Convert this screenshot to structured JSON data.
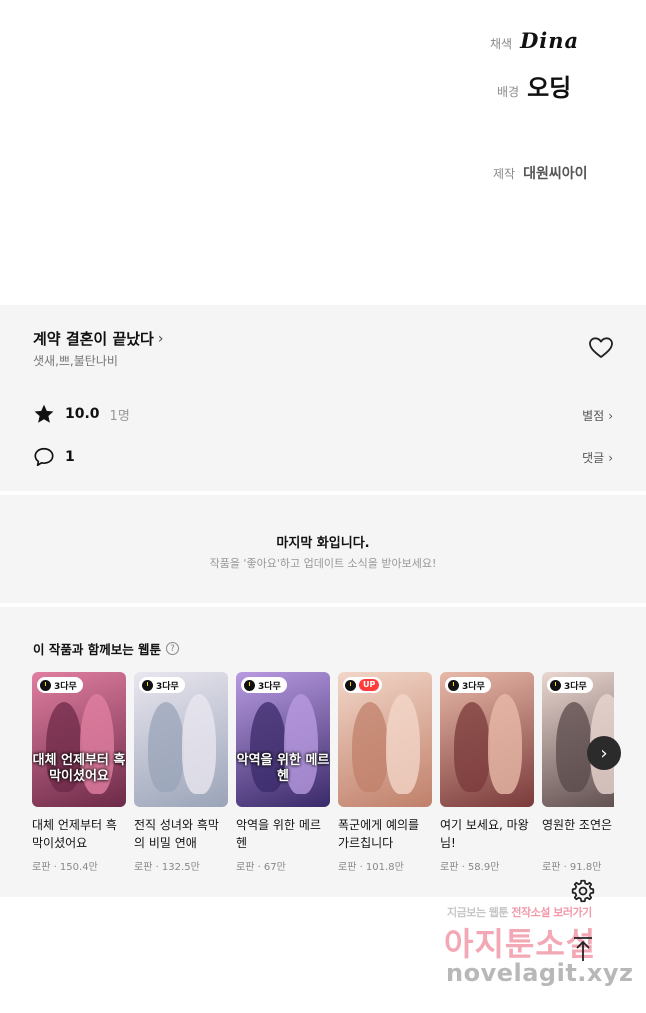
{
  "credits": [
    {
      "role": "채색",
      "name": "Dina"
    },
    {
      "role": "배경",
      "name": "오딩"
    },
    {
      "role": "제작",
      "name": "대원씨아이"
    }
  ],
  "series": {
    "title": "계약 결혼이 끝났다",
    "title_chevron": "›",
    "authors": "샛새,쁘,불탄나비",
    "rating": "10.0",
    "rating_count": "1명",
    "rating_link": "별점",
    "comment_count": "1",
    "comment_link": "댓글",
    "link_chevron": "›"
  },
  "last_episode": {
    "title": "마지막 화입니다.",
    "subtitle": "작품을 '좋아요'하고 업데이트 소식을 받아보세요!"
  },
  "recommend": {
    "heading": "이 작품과 함께보는 웹툰",
    "help": "?",
    "next": "›",
    "cards": [
      {
        "badge": "3다무",
        "badge_type": "wait",
        "thumb_text": "대체 언제부터 흑막이셨어요",
        "name": "대체 언제부터 흑막이셨어요",
        "meta": "로판 · 150.4만",
        "c1": "#6d2a48",
        "c2": "#e07ea0"
      },
      {
        "badge": "3다무",
        "badge_type": "wait",
        "thumb_text": "",
        "name": "전직 성녀와 흑막의 비밀 연애",
        "meta": "로판 · 132.5만",
        "c1": "#9aa4b8",
        "c2": "#e9e6ef"
      },
      {
        "badge": "3다무",
        "badge_type": "wait",
        "thumb_text": "악역을 위한 메르헨",
        "name": "악역을 위한 메르헨",
        "meta": "로판 · 67만",
        "c1": "#3a2a6a",
        "c2": "#b89ae0"
      },
      {
        "badge": "UP",
        "badge_type": "up",
        "thumb_text": "",
        "name": "폭군에게 예의를 가르칩니다",
        "meta": "로판 · 101.8만",
        "c1": "#c0806a",
        "c2": "#f2d6c8"
      },
      {
        "badge": "3다무",
        "badge_type": "wait",
        "thumb_text": "",
        "name": "여기 보세요, 마왕님!",
        "meta": "로판 · 58.9만",
        "c1": "#7a3a3a",
        "c2": "#e8b9a8"
      },
      {
        "badge": "3다무",
        "badge_type": "wait",
        "thumb_text": "",
        "name": "영원한 조연은 다",
        "meta": "로판 · 91.8만",
        "c1": "#5a4a4a",
        "c2": "#ead6d0"
      }
    ]
  },
  "watermark": {
    "line1_a": "지금보는 웹툰 ",
    "line1_b": "전작소설 ",
    "line1_c": "보러가기",
    "line2": "아지툰소설",
    "line3": "novelagit.xyz"
  },
  "icons": {
    "heart": "heart-icon",
    "star": "star-icon",
    "comment": "comment-icon",
    "settings": "gear-icon",
    "scroll_top": "arrow-up-to-top-icon"
  }
}
